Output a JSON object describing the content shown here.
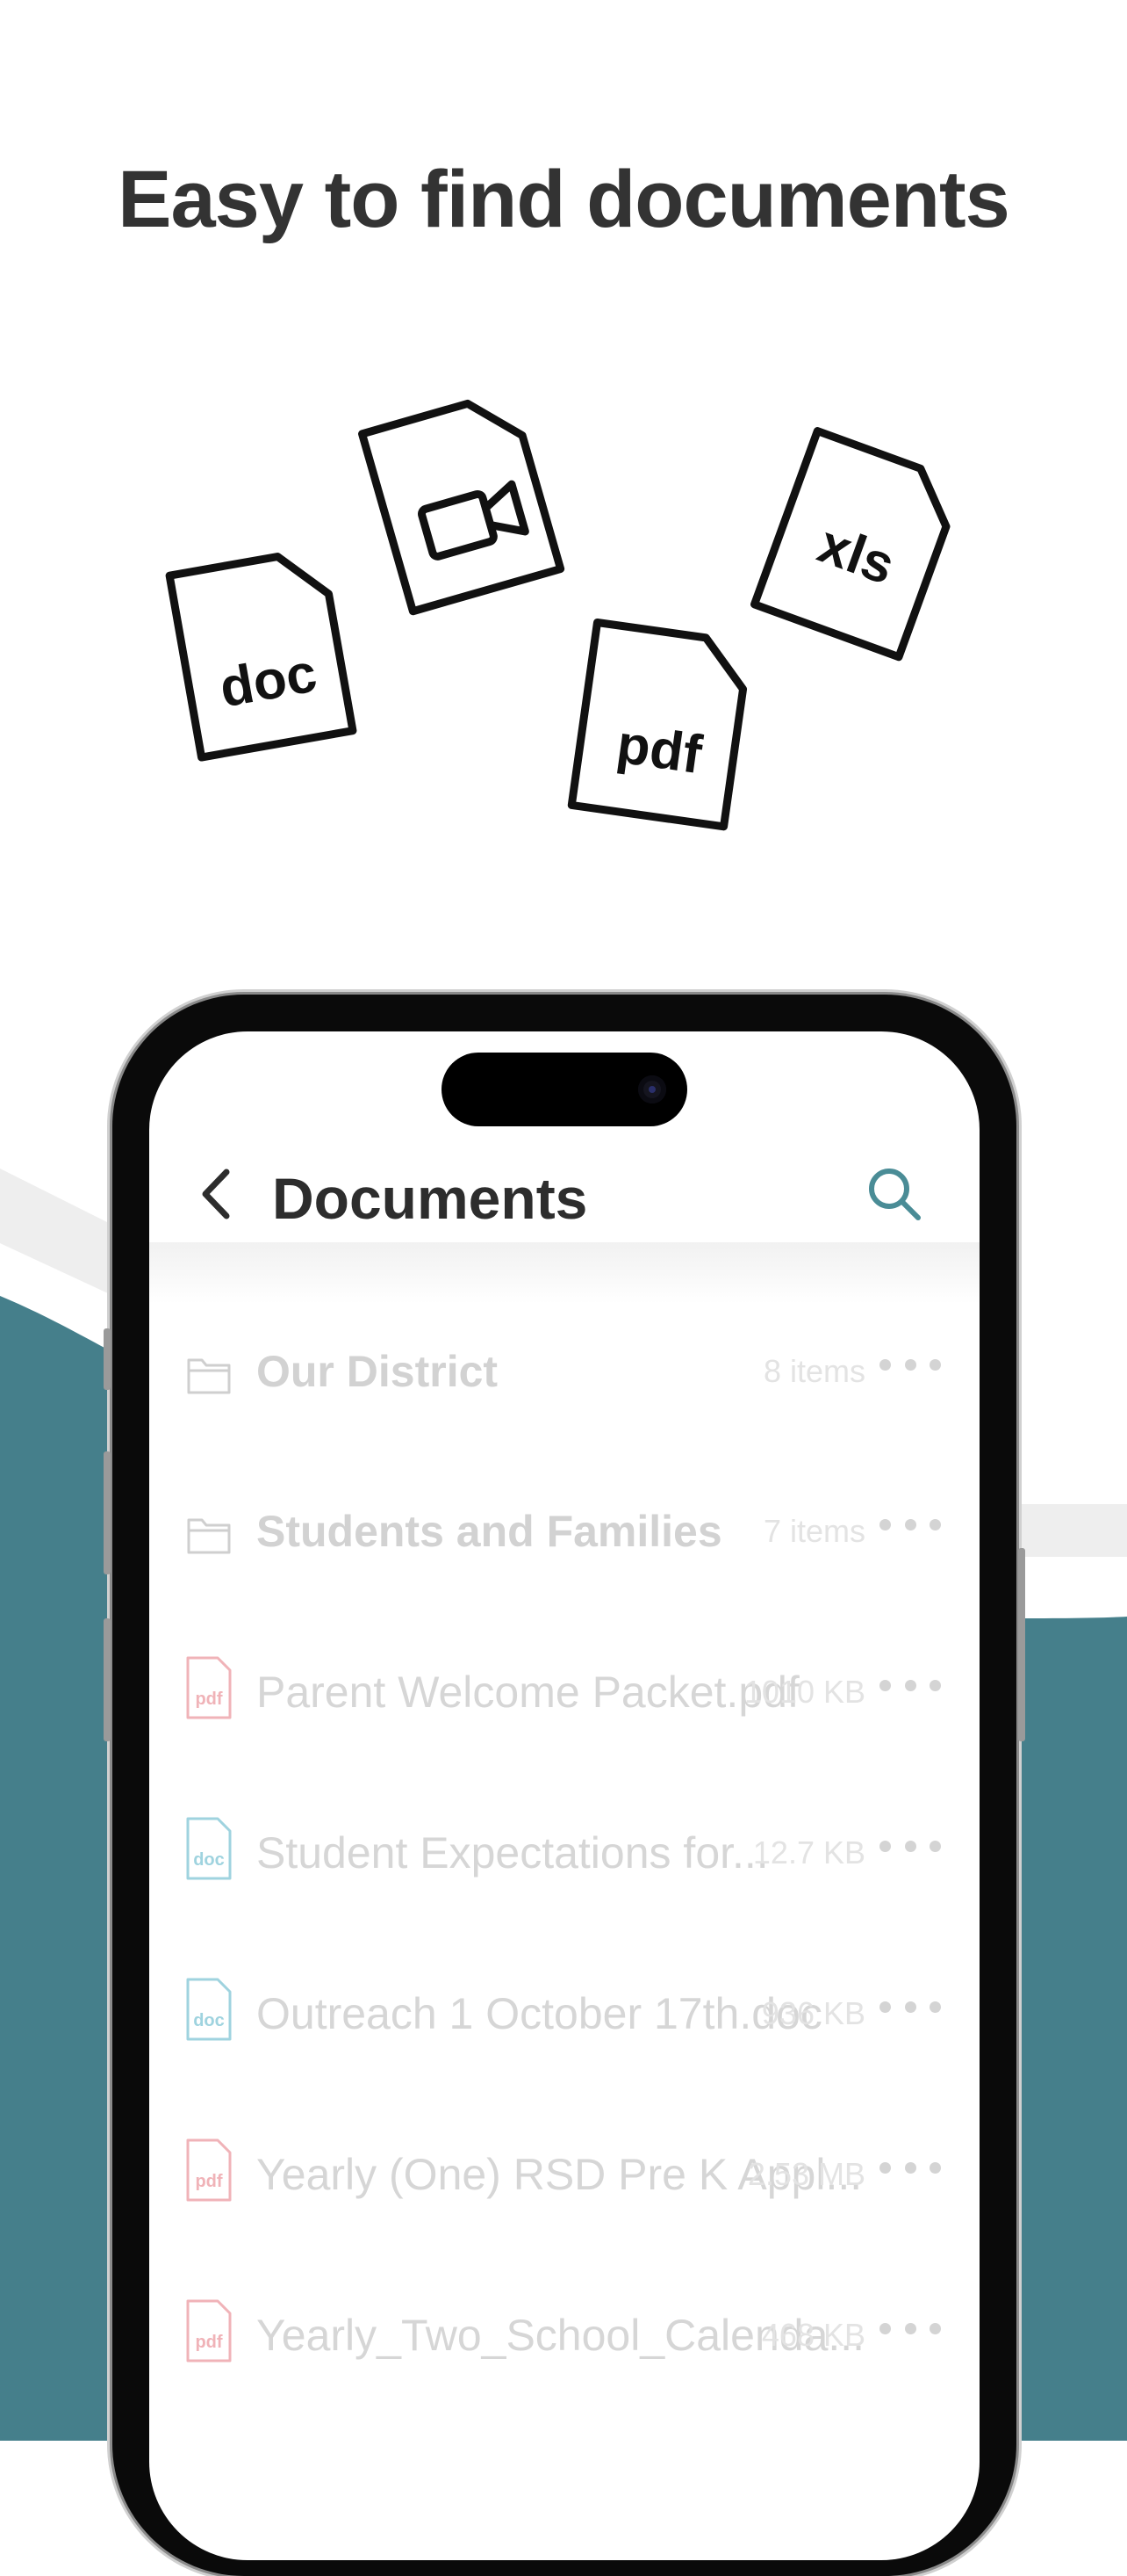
{
  "headline": "Easy to find documents",
  "colors": {
    "teal": "#457f8b",
    "accent": "#4a8c96",
    "pdf": "#f0b3b8",
    "doc": "#9fd3df",
    "folder": "#cfcfcf"
  },
  "illustration_icons": [
    {
      "name": "doc-file-icon",
      "label": "doc"
    },
    {
      "name": "video-file-icon",
      "label": ""
    },
    {
      "name": "pdf-file-icon",
      "label": "pdf"
    },
    {
      "name": "xls-file-icon",
      "label": "xls"
    }
  ],
  "app": {
    "nav": {
      "title": "Documents",
      "back_icon": "chevron-left-icon",
      "search_icon": "search-icon"
    },
    "rows": [
      {
        "type": "folder",
        "name": "Our District",
        "meta": "8 items"
      },
      {
        "type": "folder",
        "name": "Students and Families",
        "meta": "7 items"
      },
      {
        "type": "pdf",
        "name": "Parent Welcome Packet.pdf",
        "meta": "1010 KB"
      },
      {
        "type": "doc",
        "name": "Student Expectations for...",
        "meta": "12.7 KB"
      },
      {
        "type": "doc",
        "name": "Outreach 1 October 17th.doc",
        "meta": "936 KB"
      },
      {
        "type": "pdf",
        "name": "Yearly (One) RSD Pre K Appl...",
        "meta": "2.53 MB"
      },
      {
        "type": "pdf",
        "name": "Yearly_Two_School_Calenda...",
        "meta": "468 KB"
      }
    ]
  }
}
